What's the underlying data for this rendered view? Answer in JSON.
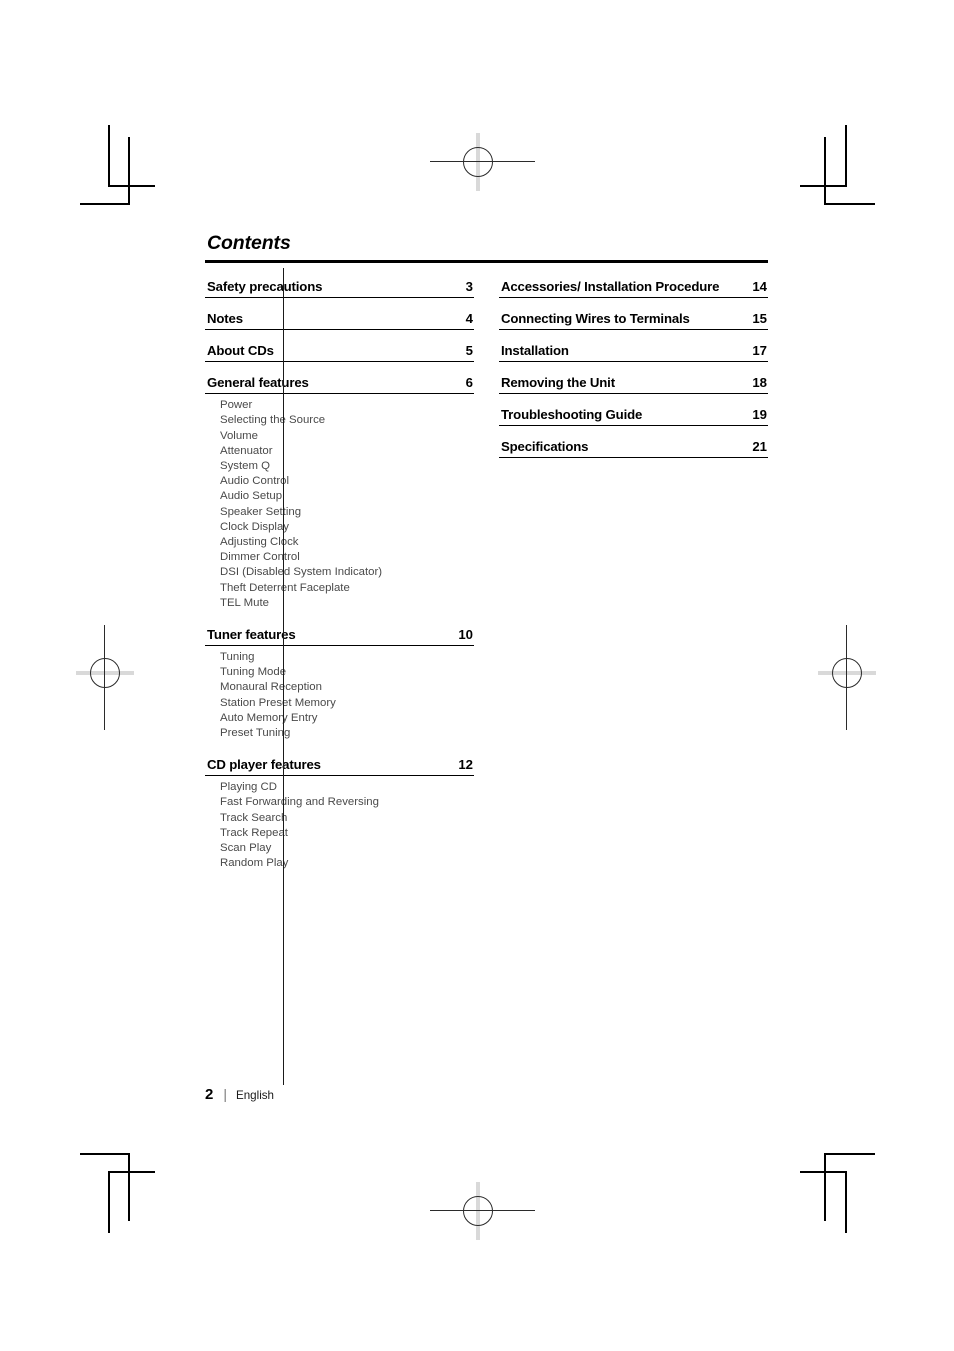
{
  "document": {
    "heading": "Contents",
    "footer": {
      "page_number": "2",
      "separator": "|",
      "language": "English"
    }
  },
  "left_column": {
    "entries": [
      {
        "label": "Safety precautions",
        "page": "3",
        "subitems": []
      },
      {
        "label": "Notes",
        "page": "4",
        "subitems": []
      },
      {
        "label": "About CDs",
        "page": "5",
        "subitems": []
      },
      {
        "label": "General features",
        "page": "6",
        "subitems": [
          "Power",
          "Selecting the Source",
          "Volume",
          "Attenuator",
          "System Q",
          "Audio Control",
          "Audio Setup",
          "Speaker Setting",
          "Clock Display",
          "Adjusting Clock",
          "Dimmer Control",
          "DSI (Disabled System Indicator)",
          "Theft Deterrent Faceplate",
          "TEL Mute"
        ]
      },
      {
        "label": "Tuner features",
        "page": "10",
        "subitems": [
          "Tuning",
          "Tuning Mode",
          "Monaural Reception",
          "Station Preset Memory",
          "Auto Memory Entry",
          "Preset Tuning"
        ]
      },
      {
        "label": "CD player features",
        "page": "12",
        "subitems": [
          "Playing CD",
          "Fast Forwarding and Reversing",
          "Track Search",
          "Track Repeat",
          "Scan Play",
          "Random Play"
        ]
      }
    ]
  },
  "right_column": {
    "entries": [
      {
        "label": "Accessories/ Installation Procedure",
        "page": "14",
        "subitems": []
      },
      {
        "label": "Connecting Wires to Terminals",
        "page": "15",
        "subitems": []
      },
      {
        "label": "Installation",
        "page": "17",
        "subitems": []
      },
      {
        "label": "Removing the Unit",
        "page": "18",
        "subitems": []
      },
      {
        "label": "Troubleshooting Guide",
        "page": "19",
        "subitems": []
      },
      {
        "label": "Specifications",
        "page": "21",
        "subitems": []
      }
    ]
  },
  "print_marks": {
    "corner_marks": [
      "top-left",
      "top-right",
      "bottom-left",
      "bottom-right"
    ],
    "registration_targets": [
      "top-center",
      "bottom-center",
      "left-middle",
      "right-middle"
    ],
    "color": "#000000"
  }
}
